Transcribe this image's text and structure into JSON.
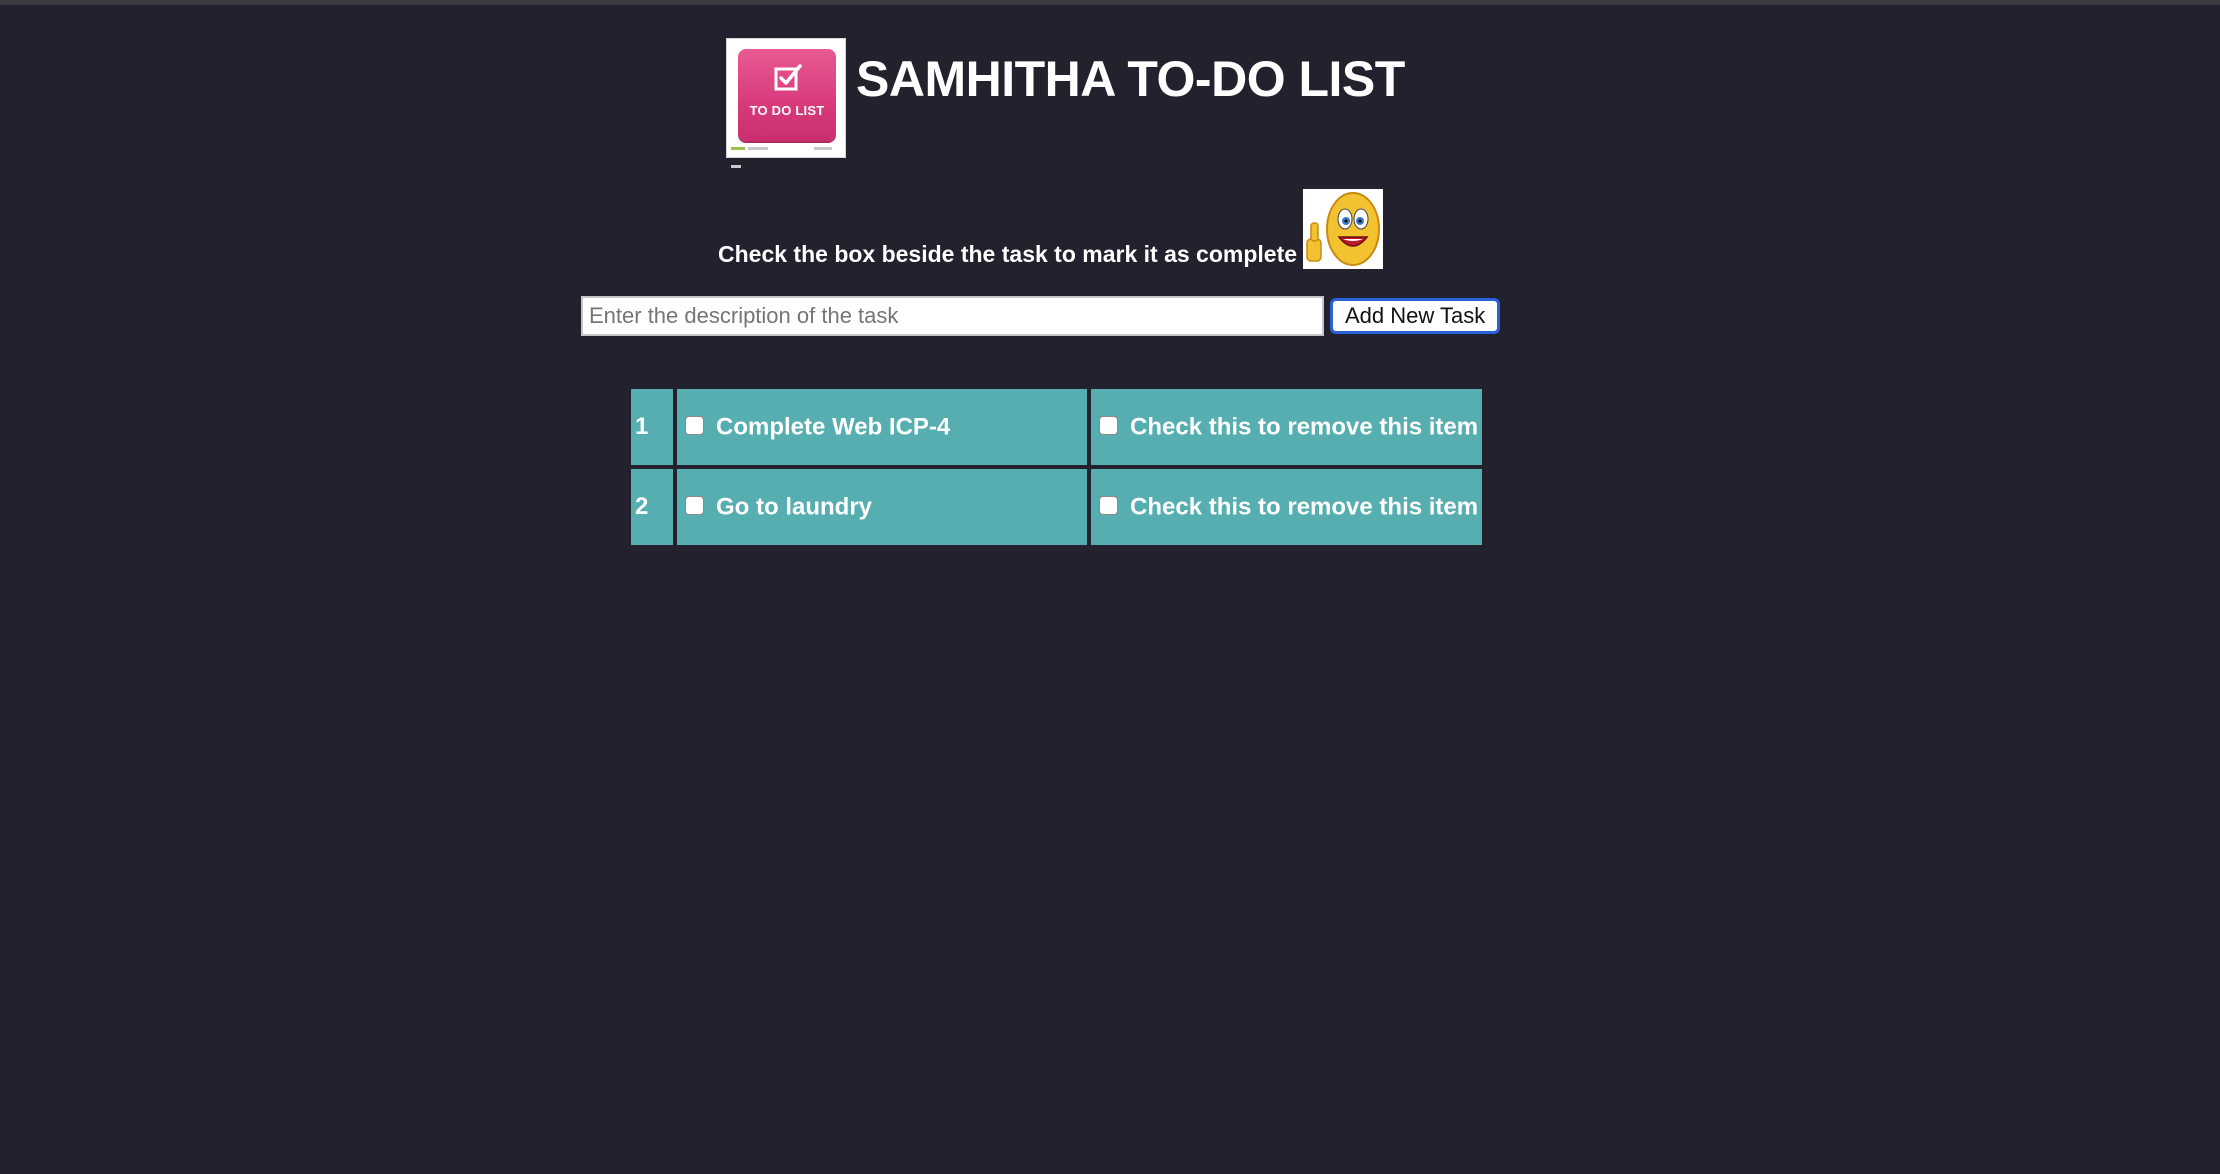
{
  "header": {
    "logo_text": "TO DO LIST",
    "title": "SAMHITHA TO-DO LIST"
  },
  "instruction": "Check the box beside the task to mark it as complete",
  "form": {
    "input_placeholder": "Enter the description of the task",
    "input_value": "",
    "add_button_label": "Add New Task"
  },
  "tasks": [
    {
      "number": "1",
      "description": "Complete Web ICP-4",
      "remove_label": "Check this to remove this item",
      "completed": false,
      "remove_checked": false
    },
    {
      "number": "2",
      "description": "Go to laundry",
      "remove_label": "Check this to remove this item",
      "completed": false,
      "remove_checked": false
    }
  ],
  "colors": {
    "background": "#23212e",
    "cell": "#56aeb0",
    "logo_pink": "#d83a7c",
    "button_border": "#2a63d8"
  },
  "icons": {
    "logo": "todo-list-logo-icon",
    "emoji": "thumbs-up-smiley-icon"
  }
}
